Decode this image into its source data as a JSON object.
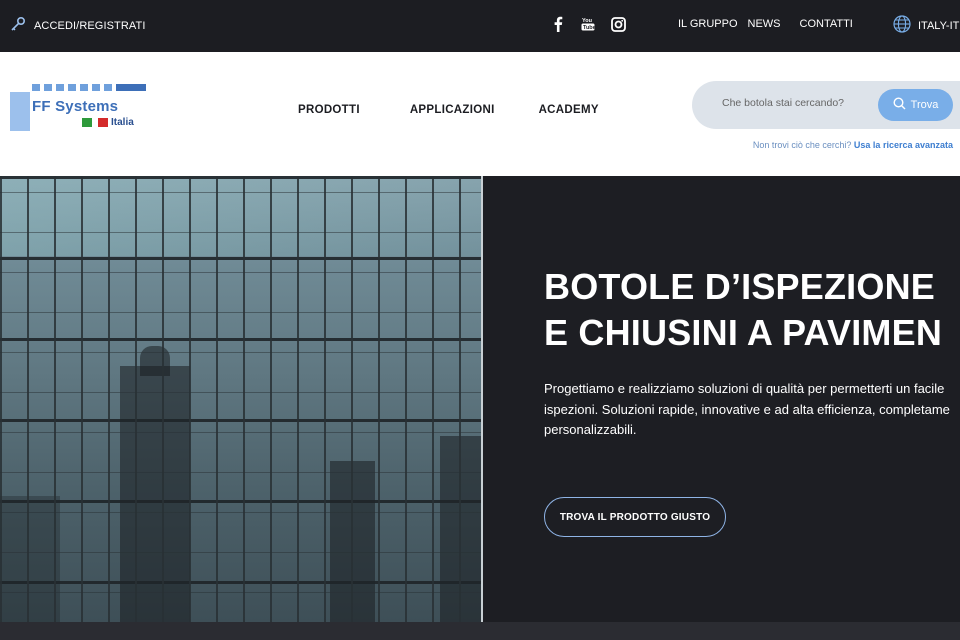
{
  "topbar": {
    "login_label": "ACCEDI/REGISTRATI",
    "login_icon": "key-icon",
    "social": [
      {
        "name": "facebook-icon",
        "glyph": "f"
      },
      {
        "name": "youtube-icon",
        "glyph": "You"
      },
      {
        "name": "instagram-icon",
        "glyph": ""
      }
    ],
    "nav": [
      "IL GRUPPO",
      "NEWS",
      "CONTATTI"
    ],
    "language": "ITALY-IT",
    "language_icon": "globe-icon"
  },
  "header": {
    "logo": {
      "brand": "FF Systems",
      "sub": "Italia"
    },
    "nav": [
      "PRODOTTI",
      "APPLICAZIONI",
      "ACADEMY"
    ],
    "search": {
      "placeholder": "Che botola stai cercando?",
      "button_label": "Trova"
    },
    "advanced": {
      "text": "Non trovi ciò che cerchi?",
      "link": "Usa la ricerca avanzata"
    }
  },
  "hero": {
    "title_line1": "BOTOLE D’ISPEZIONE",
    "title_line2": "E CHIUSINI A PAVIMEN",
    "lead_line1": "Progettiamo e realizziamo soluzioni di qualità per permetterti un facile",
    "lead_line2": "ispezioni. Soluzioni rapide, innovative e ad alta efficienza, completame",
    "lead_line3": "personalizzabili.",
    "cta_label": "TROVA IL PRODOTTO GIUSTO"
  },
  "colors": {
    "dark_bg": "#1c1d22",
    "accent_blue": "#79aee8",
    "logo_blue": "#3d6fb8"
  }
}
